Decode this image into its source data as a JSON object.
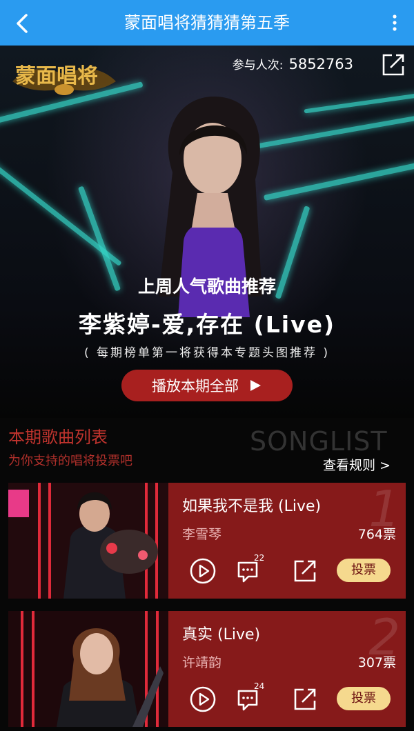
{
  "header": {
    "title": "蒙面唱将猜猜猜第五季"
  },
  "hero": {
    "logo_text": "蒙面唱将",
    "participants_label": "参与人次:",
    "participants_count": "5852763",
    "promo_heading": "上周人气歌曲推荐",
    "promo_song": "李紫婷-爱,存在 (Live)",
    "promo_note": "( 每期榜单第一将获得本专题头图推荐 )",
    "play_all_label": "播放本期全部"
  },
  "section": {
    "title": "本期歌曲列表",
    "watermark": "SONGLIST",
    "subtitle": "为你支持的唱将投票吧",
    "rules_link": "查看规则 >"
  },
  "songs": [
    {
      "rank": "1",
      "title": "如果我不是我 (Live)",
      "artist": "李雪琴",
      "votes": "764票",
      "comments": "22",
      "vote_label": "投票"
    },
    {
      "rank": "2",
      "title": "真实 (Live)",
      "artist": "许靖韵",
      "votes": "307票",
      "comments": "24",
      "vote_label": "投票"
    }
  ],
  "colors": {
    "topbar": "#2a9bf0",
    "accent_red": "#a8201f",
    "card_bg": "#861a1a",
    "vote_btn": "#f5d98e",
    "neon": "#36d6c8"
  },
  "icons": [
    "back-arrow-icon",
    "more-vertical-icon",
    "share-icon",
    "play-triangle-icon",
    "play-circle-icon",
    "comment-icon"
  ]
}
